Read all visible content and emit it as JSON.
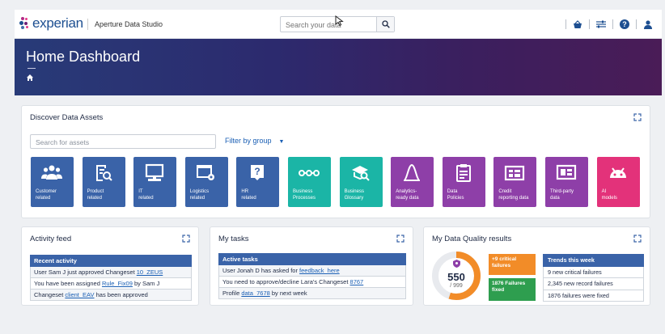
{
  "header": {
    "logo_text": "experian",
    "app_name": "Aperture Data Studio",
    "search_placeholder": "Search your data",
    "icons": [
      "search-icon",
      "basket-icon",
      "filter-sliders-icon",
      "help-icon",
      "user-icon"
    ]
  },
  "banner": {
    "title": "Home Dashboard"
  },
  "discover": {
    "title": "Discover Data Assets",
    "search_placeholder": "Search for assets",
    "filter_label": "Filter by group",
    "tiles": [
      {
        "line1": "Customer",
        "line2": "related",
        "color": "#3a63a8",
        "icon": "people-icon"
      },
      {
        "line1": "Product",
        "line2": "related",
        "color": "#3a63a8",
        "icon": "product-search-icon"
      },
      {
        "line1": "IT",
        "line2": "related",
        "color": "#3a63a8",
        "icon": "computer-icon"
      },
      {
        "line1": "Logistics",
        "line2": "related",
        "color": "#3a63a8",
        "icon": "window-gear-icon"
      },
      {
        "line1": "HR",
        "line2": "related",
        "color": "#3a63a8",
        "icon": "question-badge-icon"
      },
      {
        "line1": "Business",
        "line2": "Processes",
        "color": "#1bb5a6",
        "icon": "process-icon"
      },
      {
        "line1": "Business",
        "line2": "Glossary",
        "color": "#1bb5a6",
        "icon": "glossary-icon"
      },
      {
        "line1": "Analytics-",
        "line2": "ready data",
        "color": "#8e3fa8",
        "icon": "analytics-curve-icon"
      },
      {
        "line1": "Data",
        "line2": "Policies",
        "color": "#8e3fa8",
        "icon": "clipboard-icon"
      },
      {
        "line1": "Credit",
        "line2": "reporting data",
        "color": "#8e3fa8",
        "icon": "report-icon"
      },
      {
        "line1": "Third-party",
        "line2": "data",
        "color": "#8e3fa8",
        "icon": "third-party-icon"
      },
      {
        "line1": "AI",
        "line2": "models",
        "color": "#e3327a",
        "icon": "android-icon"
      }
    ]
  },
  "activity": {
    "title": "Activity feed",
    "header": "Recent activity",
    "rows": [
      {
        "pre": "User Sam J just approved Changeset ",
        "link": "10_ZEUS",
        "post": ""
      },
      {
        "pre": "You have been assigned ",
        "link": "Rule_Fix09",
        "post": " by Sam J"
      },
      {
        "pre": "Changeset ",
        "link": "client_EAV",
        "post": " has been approved"
      }
    ]
  },
  "tasks": {
    "title": "My tasks",
    "header": "Active tasks",
    "rows": [
      {
        "pre": "User Jonah D has asked for ",
        "link": "feedback_here",
        "post": ""
      },
      {
        "pre": "You need to approve/decline Lara's Changeset ",
        "link": "8767",
        "post": ""
      },
      {
        "pre": "Profile ",
        "link": "data_7678",
        "post": " by next week"
      }
    ]
  },
  "dq": {
    "title": "My Data Quality results",
    "score": "550",
    "score_max": "/ 999",
    "score_value": 550,
    "score_total": 999,
    "critical_badge": "+9 critical failures",
    "fixed_badge": "1876 Failures fixed",
    "trends_header": "Trends this week",
    "trends": [
      "9 new critical failures",
      "2,345 new record failures",
      "1876 failures were fixed"
    ],
    "colors": {
      "orange": "#f28c28",
      "green": "#2e9e4f",
      "track": "#e8eaee"
    }
  }
}
